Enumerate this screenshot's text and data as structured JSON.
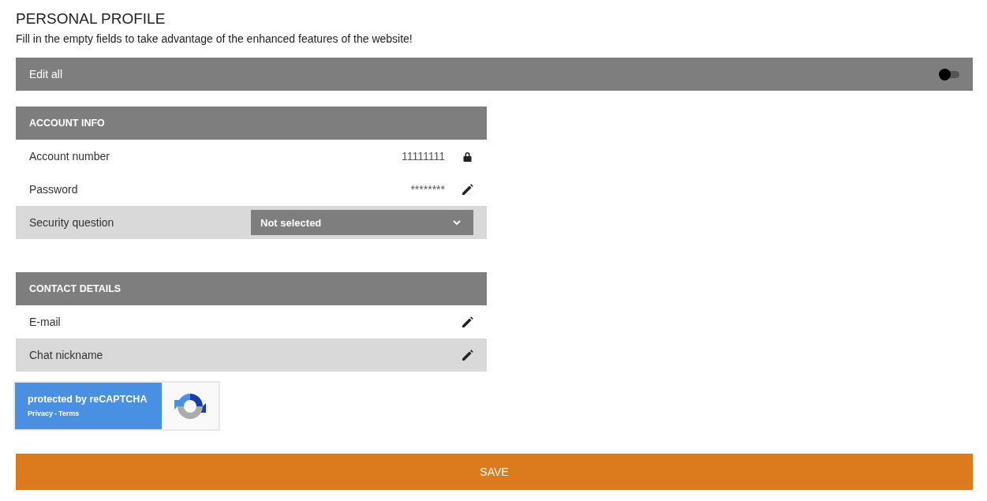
{
  "title": "PERSONAL PROFILE",
  "subtitle": "Fill in the empty fields to take advantage of the enhanced features of the website!",
  "edit_all": {
    "label": "Edit all",
    "on": false
  },
  "sections": [
    {
      "title": "ACCOUNT INFO",
      "rows": [
        {
          "kind": "value",
          "label": "Account number",
          "value": "11111111",
          "locked": true,
          "highlighted": false
        },
        {
          "kind": "value",
          "label": "Password",
          "value": "********",
          "locked": false,
          "highlighted": false
        },
        {
          "kind": "select",
          "label": "Security question",
          "value": "Not selected",
          "highlighted": true
        }
      ]
    },
    {
      "title": "CONTACT DETAILS",
      "rows": [
        {
          "kind": "value",
          "label": "E-mail",
          "locked": false,
          "highlighted": false
        },
        {
          "kind": "value",
          "label": "Chat nickname",
          "locked": false,
          "highlighted": true
        }
      ]
    }
  ],
  "captcha": {
    "text": "protected by reCAPTCHA",
    "links": [
      "Privacy",
      "Terms"
    ],
    "separator": "-"
  },
  "save_button": "SAVE"
}
